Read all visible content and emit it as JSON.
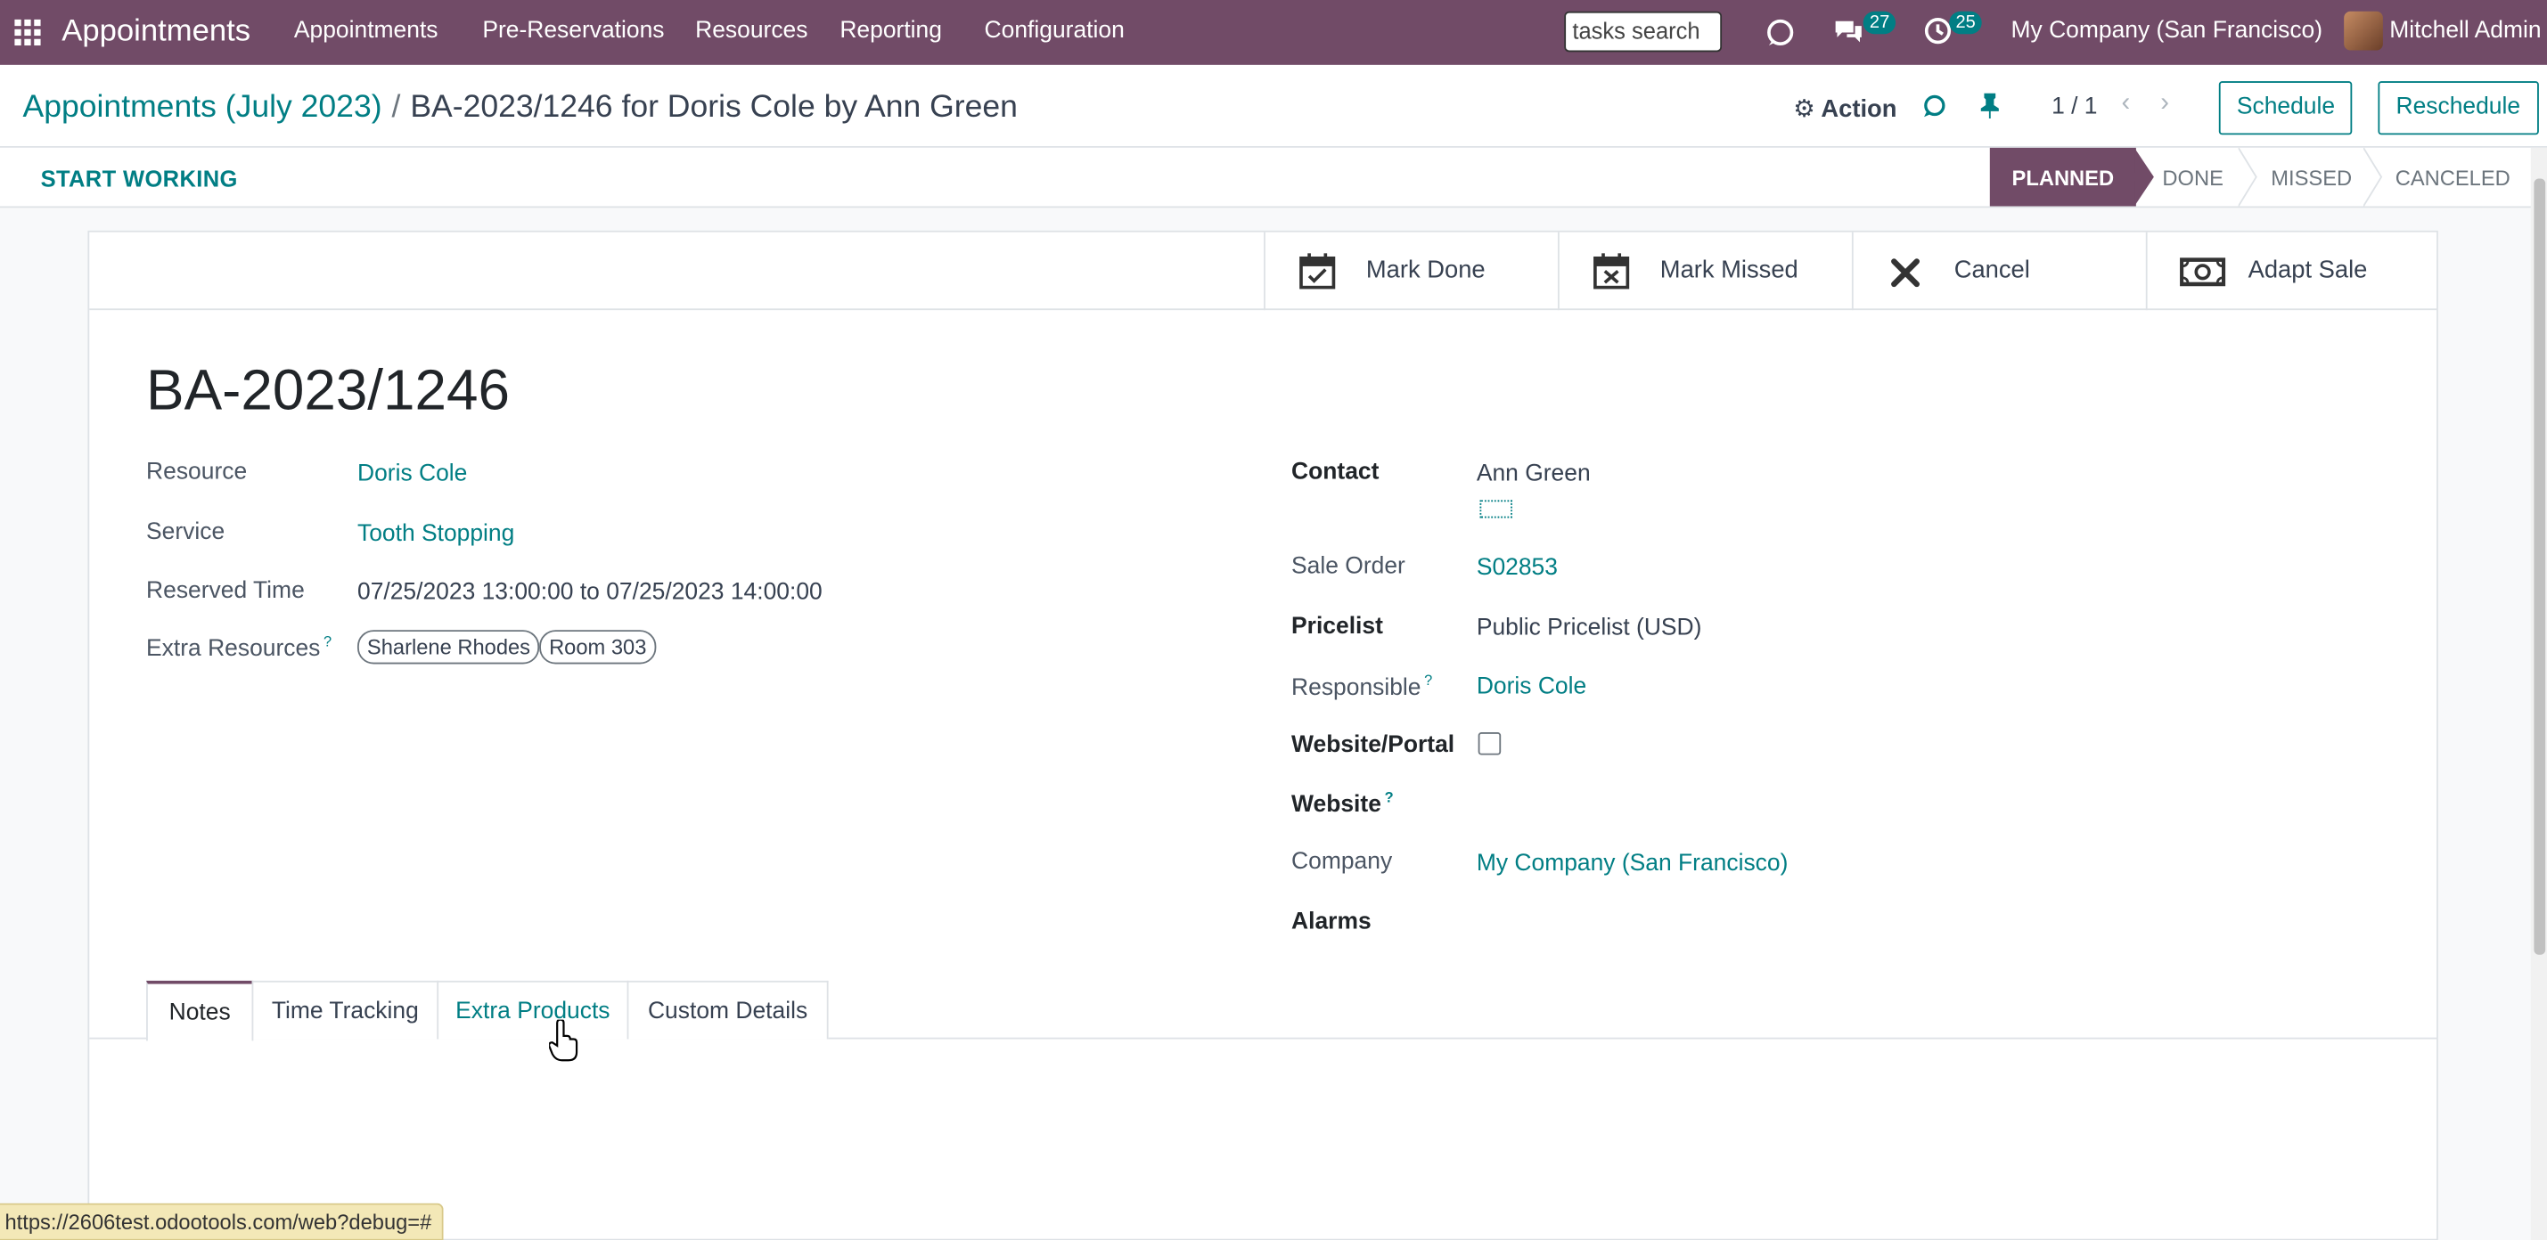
{
  "navbar": {
    "brand": "Appointments",
    "menu": [
      "Appointments",
      "Pre-Reservations",
      "Resources",
      "Reporting",
      "Configuration"
    ],
    "search_value": "tasks search",
    "messages_count": "27",
    "activities_count": "25",
    "company": "My Company (San Francisco)",
    "user": "Mitchell Admin"
  },
  "breadcrumb": {
    "parent": "Appointments (July 2023)",
    "separator": "/",
    "current": "BA-2023/1246 for Doris Cole by Ann Green"
  },
  "control": {
    "action_label": "Action",
    "pager": "1 / 1",
    "schedule_label": "Schedule",
    "reschedule_label": "Reschedule"
  },
  "statusbar": {
    "start_working": "START WORKING",
    "stages": [
      {
        "label": "PLANNED",
        "active": true
      },
      {
        "label": "DONE",
        "active": false
      },
      {
        "label": "MISSED",
        "active": false
      },
      {
        "label": "CANCELED",
        "active": false
      }
    ]
  },
  "buttons": {
    "mark_done": "Mark Done",
    "mark_missed": "Mark Missed",
    "cancel": "Cancel",
    "adapt_sale": "Adapt Sale"
  },
  "record": {
    "title": "BA-2023/1246",
    "left": {
      "resource_label": "Resource",
      "resource_value": "Doris Cole",
      "service_label": "Service",
      "service_value": "Tooth Stopping",
      "reserved_label": "Reserved Time",
      "reserved_value": "07/25/2023 13:00:00 to 07/25/2023 14:00:00",
      "extra_label": "Extra Resources",
      "extra_tags": [
        "Sharlene Rhodes",
        "Room 303"
      ]
    },
    "right": {
      "contact_label": "Contact",
      "contact_value": "Ann Green",
      "sale_order_label": "Sale Order",
      "sale_order_value": "S02853",
      "pricelist_label": "Pricelist",
      "pricelist_value": "Public Pricelist (USD)",
      "responsible_label": "Responsible",
      "responsible_value": "Doris Cole",
      "website_portal_label": "Website/Portal",
      "website_label": "Website",
      "company_label": "Company",
      "company_value": "My Company (San Francisco)",
      "alarms_label": "Alarms"
    },
    "help_mark": "?"
  },
  "tabs": [
    "Notes",
    "Time Tracking",
    "Extra Products",
    "Custom Details"
  ],
  "status_url": "https://2606test.odootools.com/web?debug=#",
  "colors": {
    "brand": "#714B67",
    "accent": "#017e84",
    "status_url_bg": "#f3e8b7"
  }
}
